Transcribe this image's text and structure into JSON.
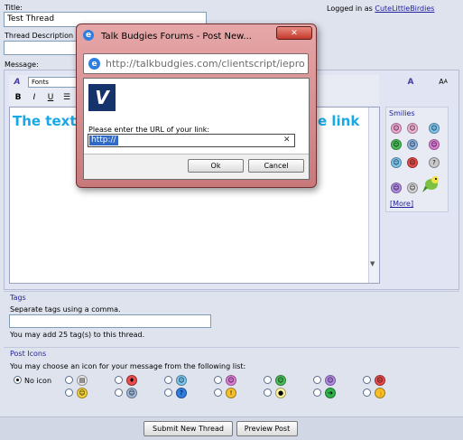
{
  "form": {
    "title_label": "Title:",
    "title_value": "Test Thread",
    "logged_in_prefix": "Logged in as",
    "username": "CuteLittleBirdies",
    "description_label": "Thread Description",
    "message_label": "Message:",
    "fonts_label": "Fonts",
    "editor_text_left": "The text",
    "editor_text_right": "e link"
  },
  "toolbar": {
    "bold": "B",
    "italic": "I",
    "underline": "U",
    "font_size": "A"
  },
  "smilies": {
    "label": "Smilies",
    "more": "[More]",
    "faces": [
      {
        "glyph": "☺",
        "color": "#f4a8d6"
      },
      {
        "glyph": "☺",
        "color": "#f7b5d8"
      },
      {
        "glyph": "☺",
        "color": "#7ec8f2"
      },
      {
        "glyph": "☺",
        "color": "#4cc05a"
      },
      {
        "glyph": "☺",
        "color": "#8fb7e6"
      },
      {
        "glyph": "☺",
        "color": "#e07fd8"
      },
      {
        "glyph": "☺",
        "color": "#7ec8f2"
      },
      {
        "glyph": "☹",
        "color": "#e84c4c"
      },
      {
        "glyph": "?",
        "color": "#c9c9c9"
      },
      {
        "glyph": "☺",
        "color": "#b58de8"
      },
      {
        "glyph": "☺",
        "color": "#d6d6d6"
      }
    ]
  },
  "tags": {
    "heading": "Tags",
    "instruction": "Separate tags using a comma.",
    "remaining": "You may add 25 tag(s) to this thread."
  },
  "post_icons": {
    "heading": "Post Icons",
    "instruction": "You may choose an icon for your message from the following list:",
    "no_icon": "No icon",
    "icons": [
      {
        "glyph": "▤",
        "color": "#e8e8e8"
      },
      {
        "glyph": "♦",
        "color": "#e84c4c"
      },
      {
        "glyph": "☺",
        "color": "#7ec8f2"
      },
      {
        "glyph": "☺",
        "color": "#e07fd8"
      },
      {
        "glyph": "☺",
        "color": "#4cc05a"
      },
      {
        "glyph": "☺",
        "color": "#b58de8"
      },
      {
        "glyph": "☹",
        "color": "#e84c4c"
      },
      {
        "glyph": "☺",
        "color": "#f5d23a"
      },
      {
        "glyph": "☺",
        "color": "#9fb9d9"
      },
      {
        "glyph": "?",
        "color": "#2f7de0"
      },
      {
        "glyph": "!",
        "color": "#f5c02a"
      },
      {
        "glyph": "●",
        "color": "#fff6a0"
      },
      {
        "glyph": "➔",
        "color": "#2fb24a"
      },
      {
        "glyph": "👍",
        "color": "#f5c02a"
      }
    ]
  },
  "actions": {
    "submit": "Submit New Thread",
    "preview": "Preview Post"
  },
  "dialog": {
    "window_title": "Talk Budgies Forums - Post New...",
    "url": "http://talkbudgies.com/clientscript/iepro",
    "prompt": "Please enter the URL of your link:",
    "input_value": "http://",
    "ok": "Ok",
    "cancel": "Cancel",
    "close_glyph": "✕",
    "clear_glyph": "✕"
  }
}
